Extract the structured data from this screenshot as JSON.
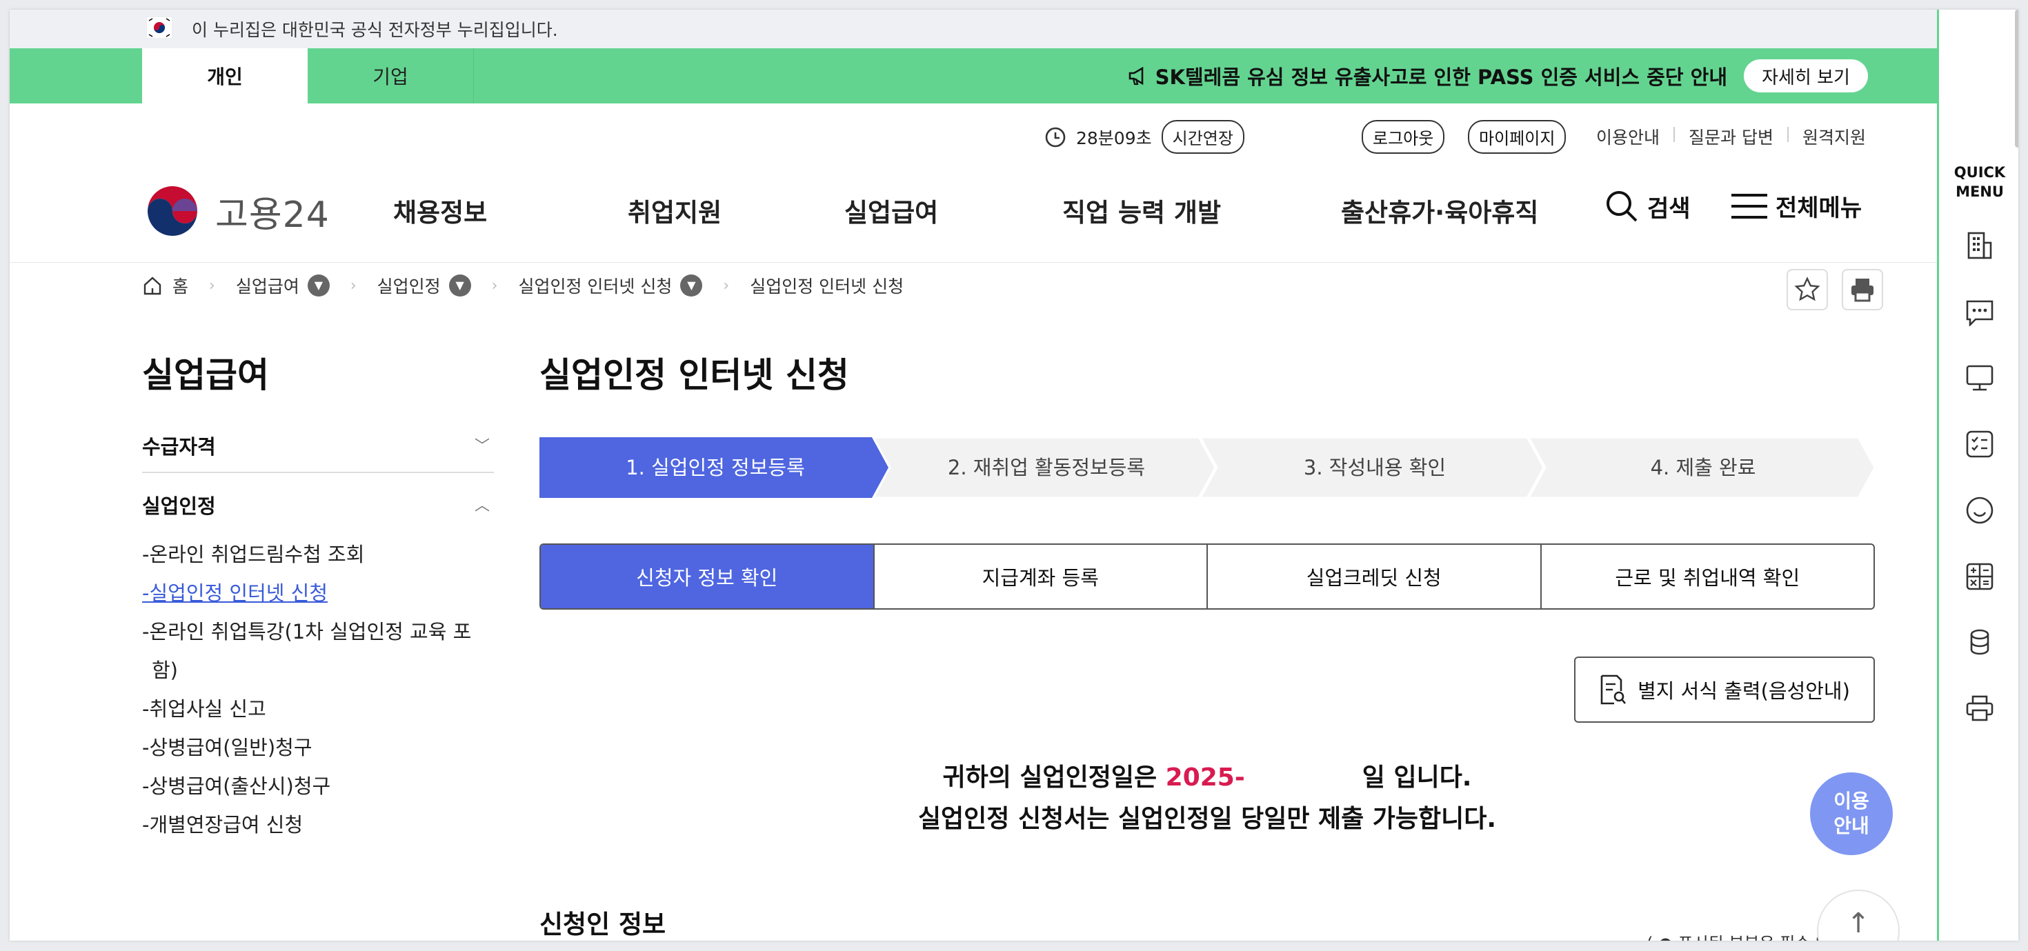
{
  "gov_notice": "이 누리집은 대한민국 공식 전자정부 누리집입니다.",
  "tabs": {
    "person": "개인",
    "business": "기업"
  },
  "announcement": {
    "text": "SK텔레콤 유심 정보 유출사고로 인한 PASS 인증 서비스 중단 안내",
    "button": "자세히 보기"
  },
  "session": {
    "time": "28분09초",
    "extend": "시간연장"
  },
  "util": {
    "logout": "로그아웃",
    "mypage": "마이페이지",
    "links": [
      "이용안내",
      "질문과 답변",
      "원격지원"
    ]
  },
  "logo": "고용24",
  "gnb": [
    "채용정보",
    "취업지원",
    "실업급여",
    "직업 능력 개발",
    "출산휴가·육아휴직"
  ],
  "search": "검색",
  "allmenu": "전체메뉴",
  "breadcrumb": [
    "홈",
    "실업급여",
    "실업인정",
    "실업인정 인터넷 신청",
    "실업인정 인터넷 신청"
  ],
  "sidebar": {
    "title": "실업급여",
    "sections": [
      {
        "label": "수급자격",
        "expanded": false
      },
      {
        "label": "실업인정",
        "expanded": true
      }
    ],
    "items": [
      "온라인 취업드림수첩 조회",
      "실업인정 인터넷 신청",
      "온라인 취업특강(1차 실업인정 교육 포함)",
      "취업사실 신고",
      "상병급여(일반)청구",
      "상병급여(출산시)청구",
      "개별연장급여 신청"
    ]
  },
  "page_title": "실업인정 인터넷 신청",
  "steps": [
    "1. 실업인정 정보등록",
    "2. 재취업 활동정보등록",
    "3. 작성내용 확인",
    "4. 제출 완료"
  ],
  "subtabs": [
    "신청자 정보 확인",
    "지급계좌 등록",
    "실업크레딧 신청",
    "근로 및 취업내역 확인"
  ],
  "print_button": "별지 서식 출력(음성안내)",
  "message": {
    "line1_pre": "귀하의 실업인정일은 ",
    "line1_date": "2025-",
    "line1_post": "일 입니다.",
    "line2": "실업인정 신청서는 실업인정일 당일만 제출 가능합니다."
  },
  "applicant_title": "신청인 정보",
  "required_note": "( ● 표시된 부분은 필수 입력 항목",
  "quick_menu": {
    "title_line1": "QUICK",
    "title_line2": "MENU",
    "icons": [
      "building-icon",
      "chat-icon",
      "monitor-icon",
      "checklist-icon",
      "smile-icon",
      "calculator-icon",
      "coins-icon",
      "printer-icon"
    ]
  },
  "help": {
    "line1": "이용",
    "line2": "안내"
  },
  "colors": {
    "green": "#63d490",
    "blue": "#4f66e0",
    "red": "#d81b50",
    "help": "#7f97f2"
  }
}
